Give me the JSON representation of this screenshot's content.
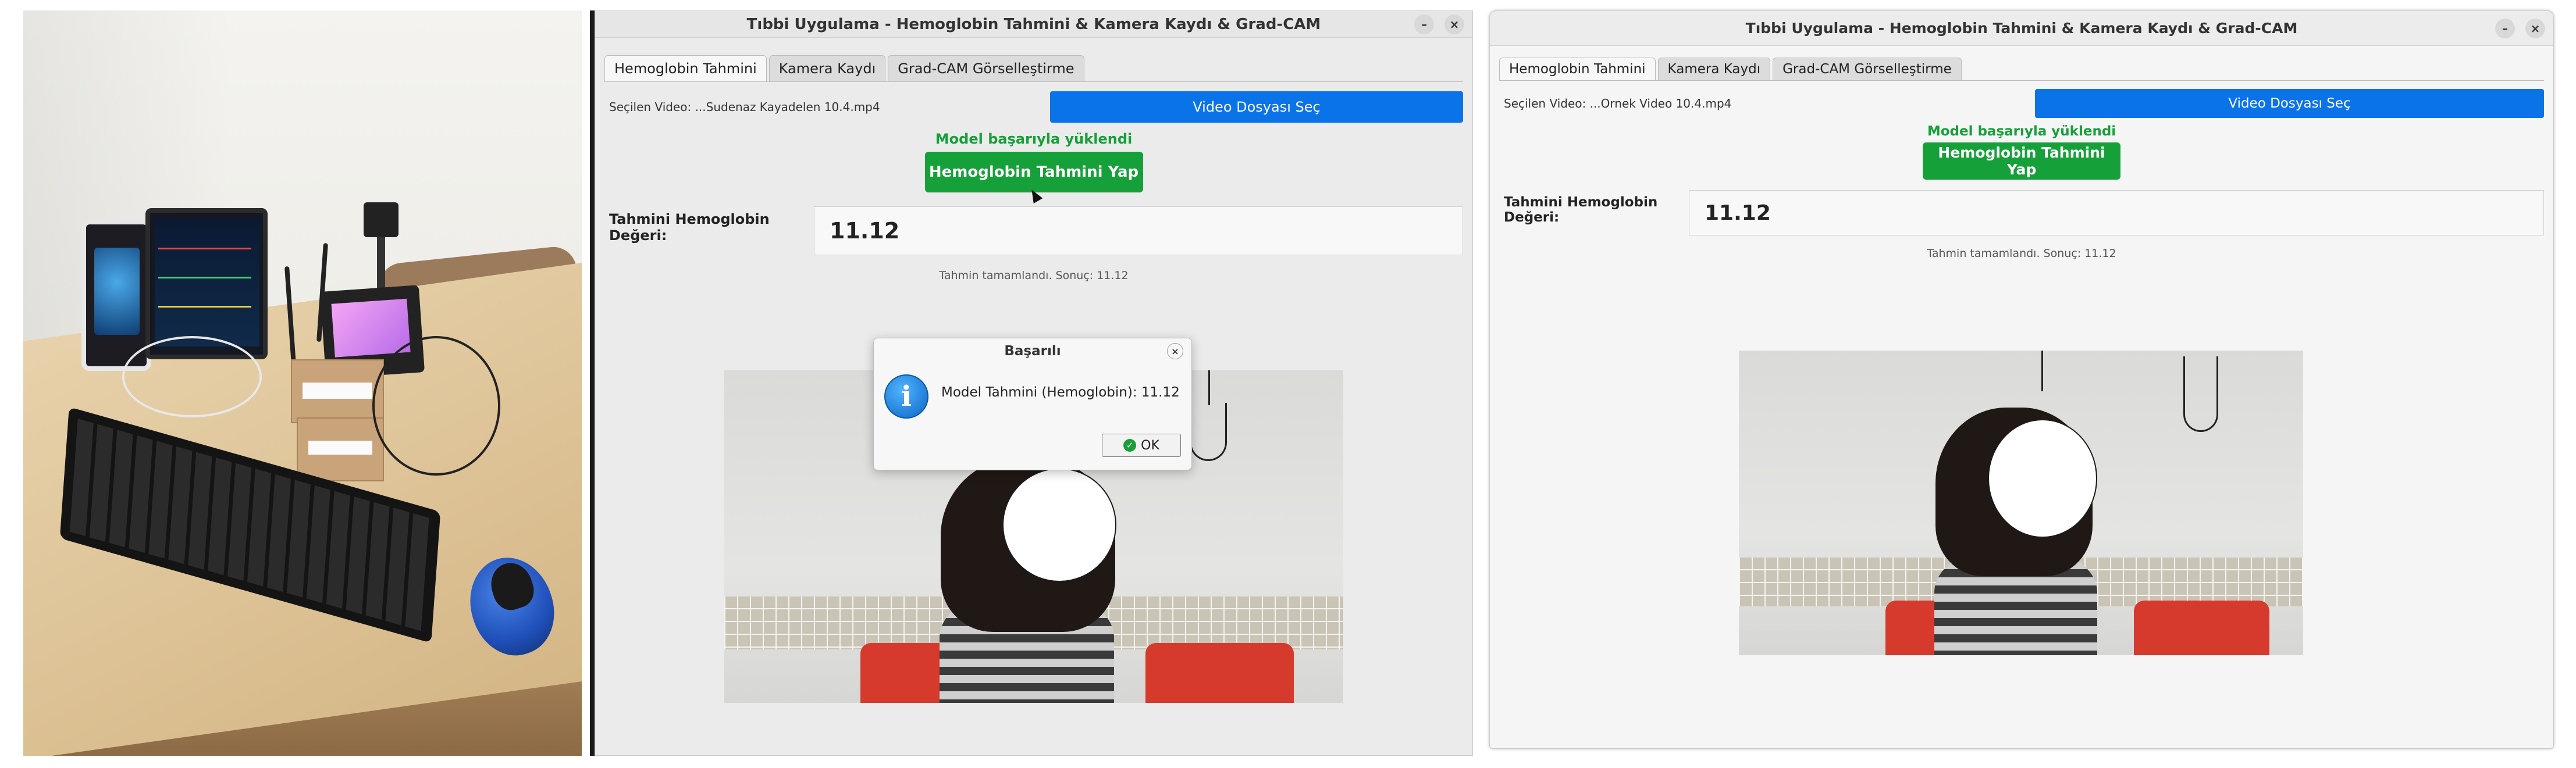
{
  "window_left": {
    "title": "Tıbbi Uygulama - Hemoglobin Tahmini & Kamera Kaydı & Grad-CAM",
    "controls": {
      "minimize": "–",
      "close": "×"
    },
    "tabs": [
      {
        "label": "Hemoglobin Tahmini",
        "active": true
      },
      {
        "label": "Kamera Kaydı",
        "active": false
      },
      {
        "label": "Grad-CAM Görselleştirme",
        "active": false
      }
    ],
    "selected_video": "Seçilen Video: ...Sudenaz Kayadelen 10.4.mp4",
    "select_video_button": "Video Dosyası Seç",
    "model_loaded": "Model başarıyla yüklendi",
    "predict_button": "Hemoglobin Tahmini Yap",
    "hb_label": "Tahmini Hemoglobin Değeri:",
    "hb_value": "11.12",
    "status": "Tahmin tamamlandı. Sonuç: 11.12",
    "dialog": {
      "title": "Başarılı",
      "close": "×",
      "icon": "info-icon",
      "message": "Model Tahmini (Hemoglobin): 11.12",
      "ok_label": "OK"
    }
  },
  "window_right": {
    "title": "Tıbbi Uygulama - Hemoglobin Tahmini & Kamera Kaydı & Grad-CAM",
    "controls": {
      "minimize": "–",
      "close": "×"
    },
    "tabs": [
      {
        "label": "Hemoglobin Tahmini",
        "active": true
      },
      {
        "label": "Kamera Kaydı",
        "active": false
      },
      {
        "label": "Grad-CAM Görselleştirme",
        "active": false
      }
    ],
    "selected_video": "Seçilen Video: ...Ornek Video 10.4.mp4",
    "select_video_button": "Video Dosyası Seç",
    "model_loaded": "Model başarıyla yüklendi",
    "predict_button": "Hemoglobin Tahmini Yap",
    "hb_label": "Tahmini Hemoglobin Değeri:",
    "hb_value": "11.12",
    "status": "Tahmin tamamlandı. Sonuç: 11.12"
  },
  "colors": {
    "accent_blue": "#0b73e8",
    "success_green": "#16a039"
  }
}
